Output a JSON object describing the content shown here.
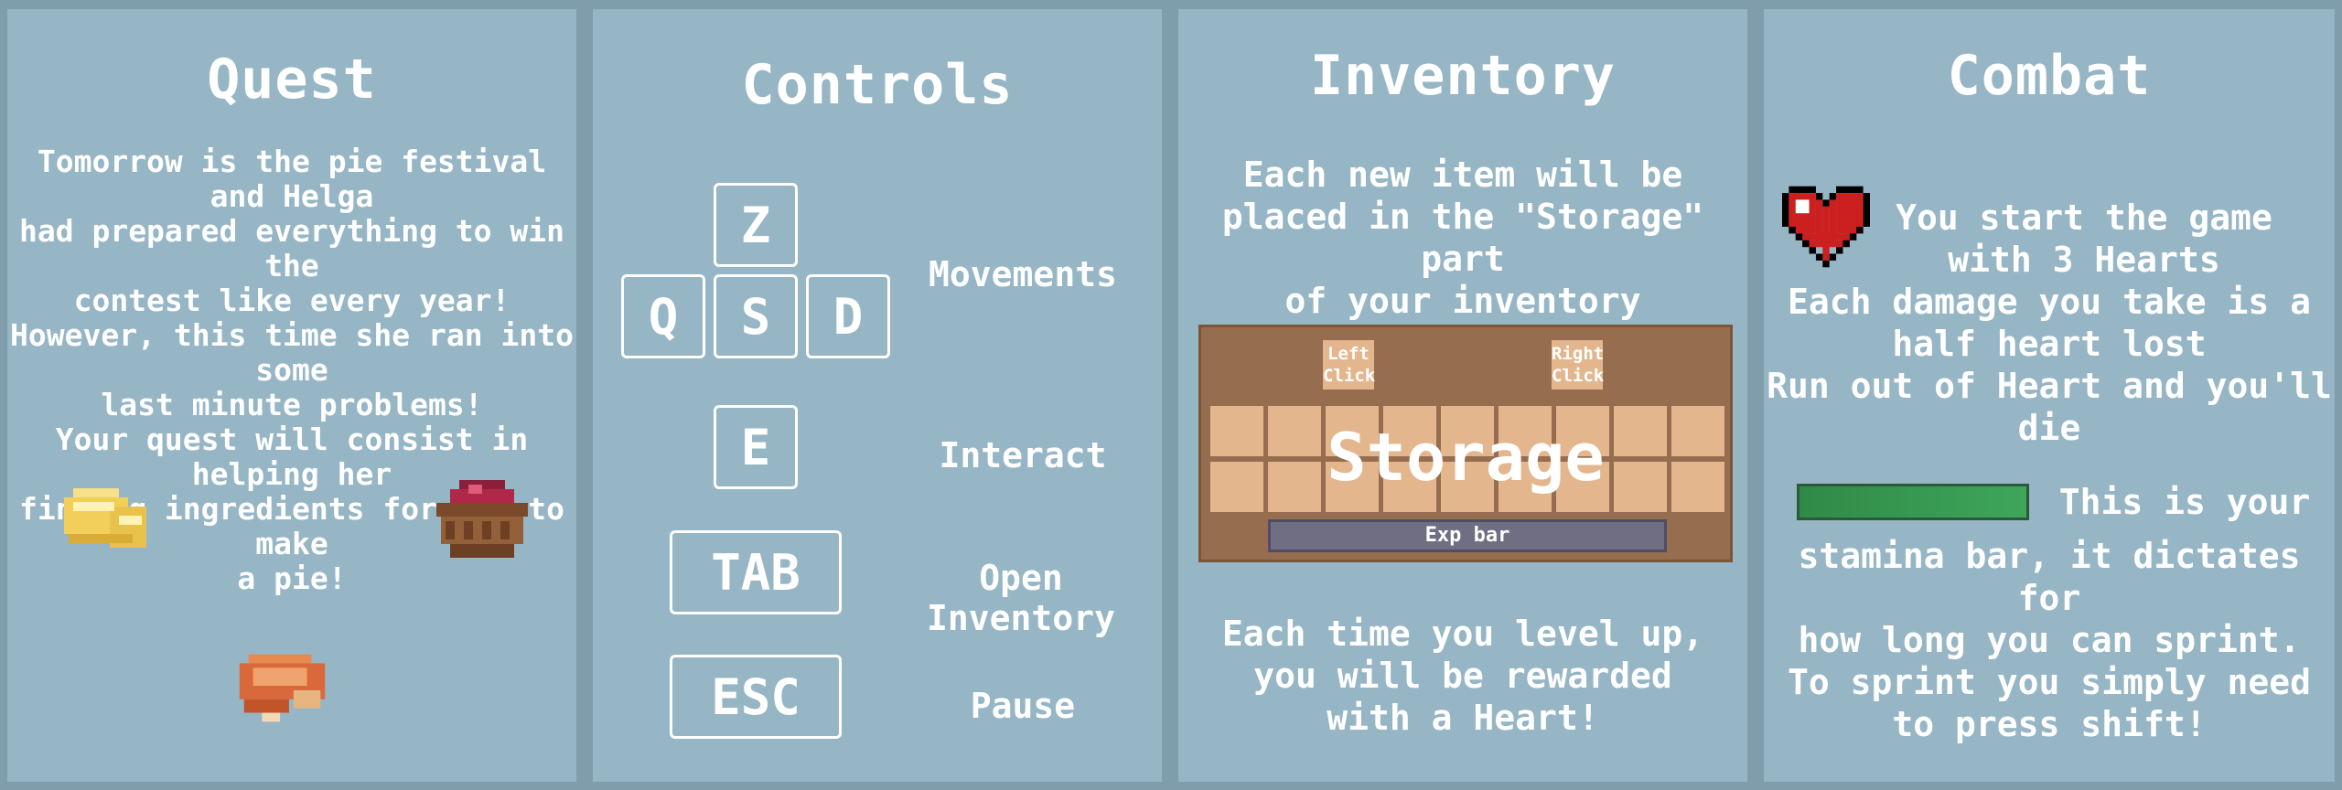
{
  "quest": {
    "title": "Quest",
    "text": "Tomorrow is the pie festival and Helga\nhad prepared everything to win the\ncontest like every year!\nHowever, this time she ran into some\nlast minute problems!\nYour quest will consist in helping her\nfinding ingredients for her to make\na pie!",
    "icons": [
      "butter-icon",
      "berry-basket-icon",
      "pie-icon"
    ]
  },
  "controls": {
    "title": "Controls",
    "keys": {
      "z": "Z",
      "q": "Q",
      "s": "S",
      "d": "D",
      "e": "E",
      "tab": "TAB",
      "esc": "ESC"
    },
    "labels": {
      "movements": "Movements",
      "interact": "Interact",
      "open_inventory": "Open Inventory",
      "pause": "Pause"
    }
  },
  "inventory": {
    "title": "Inventory",
    "text_top": "Each new item will be\nplaced in the \"Storage\" part\nof your inventory",
    "left_click": "Left\nClick",
    "right_click": "Right\nClick",
    "storage": "Storage",
    "exp_bar": "Exp bar",
    "text_bottom": "Each time you level up,\nyou will be rewarded\nwith a Heart!"
  },
  "combat": {
    "title": "Combat",
    "hearts_text": "You start the game\nwith 3 Hearts",
    "damage_text": "Each damage you take is a\nhalf heart lost\nRun out of Heart and you'll die",
    "stamina_first": "This is your",
    "stamina_text": "stamina bar, it dictates for\nhow long you can sprint.\nTo sprint you simply need\nto press shift!",
    "stamina_level": 1.0
  },
  "colors": {
    "background": "#7f9dab",
    "panel": "#96b6c5",
    "inventory_box": "#966e4f",
    "slot": "#e3b68e",
    "exp_bar": "#6f6e83",
    "stamina": "#3fa65a",
    "heart": "#cc1f1f"
  }
}
